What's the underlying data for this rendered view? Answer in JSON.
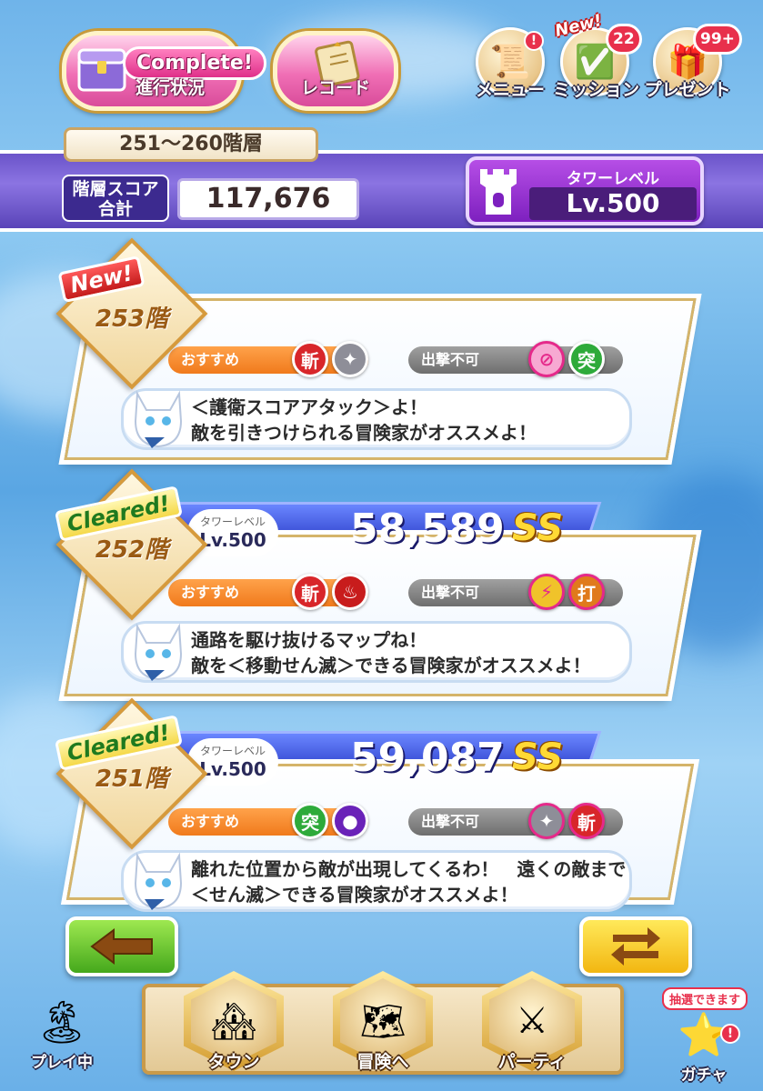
{
  "top": {
    "progress": {
      "tag": "Complete!",
      "label": "進行状況"
    },
    "record": {
      "label": "レコード"
    },
    "menu": {
      "label": "メニュー",
      "alert": "!"
    },
    "mission": {
      "label": "ミッション",
      "new_tag": "New!",
      "badge": "22"
    },
    "present": {
      "label": "プレゼント",
      "badge": "99+"
    }
  },
  "header": {
    "floor_range": "251～260階層",
    "score_label_line1": "階層スコア",
    "score_label_line2": "合計",
    "score_total": "117,676",
    "tower_level_title": "タワーレベル",
    "tower_level": "Lv.500"
  },
  "floors": [
    {
      "status": "New!",
      "floor": "253階",
      "recommend_label": "おすすめ",
      "recommend_icons": [
        "斬",
        "shuriken-icon"
      ],
      "banned_label": "出撃不可",
      "banned_icons": [
        "wand-icon",
        "突"
      ],
      "message_line1": "＜護衛スコアアタック＞よ！",
      "message_line2": "敵を引きつけられる冒険家がオススメよ！"
    },
    {
      "status": "Cleared!",
      "floor": "252階",
      "level_title": "タワーレベル",
      "level": "Lv.500",
      "score": "58,589",
      "rank": "SS",
      "recommend_label": "おすすめ",
      "recommend_icons": [
        "斬",
        "fire-icon"
      ],
      "banned_label": "出撃不可",
      "banned_icons": [
        "lightning-icon",
        "打"
      ],
      "message_line1": "通路を駆け抜けるマップね！",
      "message_line2": "敵を＜移動せん滅＞できる冒険家がオススメよ！"
    },
    {
      "status": "Cleared!",
      "floor": "251階",
      "level_title": "タワーレベル",
      "level": "Lv.500",
      "score": "59,087",
      "rank": "SS",
      "recommend_label": "おすすめ",
      "recommend_icons": [
        "突",
        "orb-icon"
      ],
      "banned_label": "出撃不可",
      "banned_icons": [
        "shuriken-icon",
        "斬"
      ],
      "message_line1": "離れた位置から敵が出現してくるわ！　遠くの敵まで",
      "message_line2": "＜せん滅＞できる冒険家がオススメよ！"
    }
  ],
  "bottom": {
    "back": "back-arrow-icon",
    "swap": "swap-icon",
    "playing": "プレイ中",
    "town": "タウン",
    "adventure": "冒険へ",
    "party": "パーティ",
    "gacha": "ガチャ",
    "gacha_note": "抽選できます",
    "gacha_alert": "!"
  },
  "colors": {
    "band": "#6b54c9",
    "tower": "#9a36d6",
    "recommend": "#f58a2a",
    "banned": "#8a8a8a",
    "ribbon": "#3b50d6",
    "rank": "#ffd935"
  }
}
